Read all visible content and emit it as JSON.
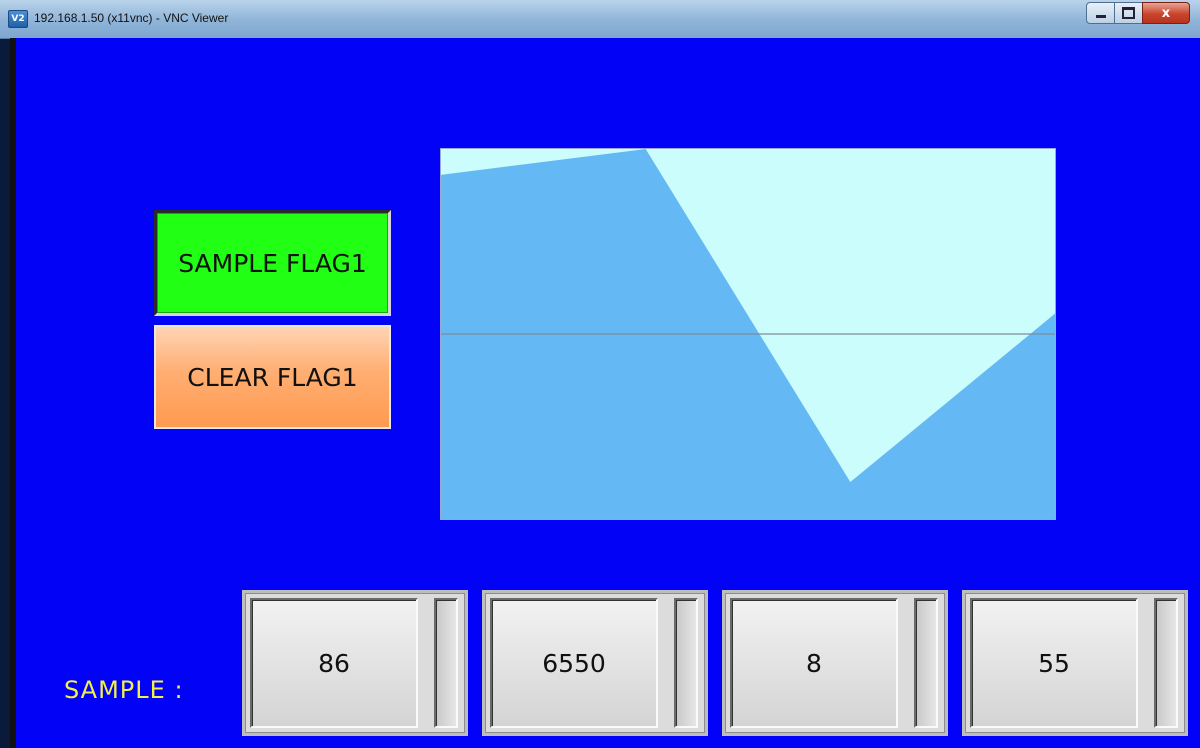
{
  "window": {
    "title": "192.168.1.50 (x11vnc) - VNC Viewer",
    "app_icon_text": "V2",
    "controls": {
      "minimize": "",
      "maximize": "",
      "close": "x"
    }
  },
  "screen": {
    "background_color": "#0202f6",
    "buttons": {
      "sample_flag": {
        "label": "SAMPLE FLAG1",
        "color": "#20ff14"
      },
      "clear_flag": {
        "label": "CLEAR FLAG1",
        "color": "#ffae72"
      }
    },
    "sample_label": "SAMPLE :",
    "values": [
      "86",
      "6550",
      "8",
      "55"
    ]
  },
  "chart_data": {
    "type": "area",
    "title": "",
    "xlabel": "",
    "ylabel": "",
    "x": [
      0,
      1,
      2,
      3
    ],
    "series": [
      {
        "values": [
          86,
          100,
          -80,
          11
        ]
      }
    ],
    "ylim": [
      -100,
      100
    ],
    "baseline": 0,
    "fill_color": "#64b8f4",
    "background_color": "#cbfdfd",
    "baseline_color": "#7d8c9a",
    "grid": false,
    "legend": "none"
  }
}
